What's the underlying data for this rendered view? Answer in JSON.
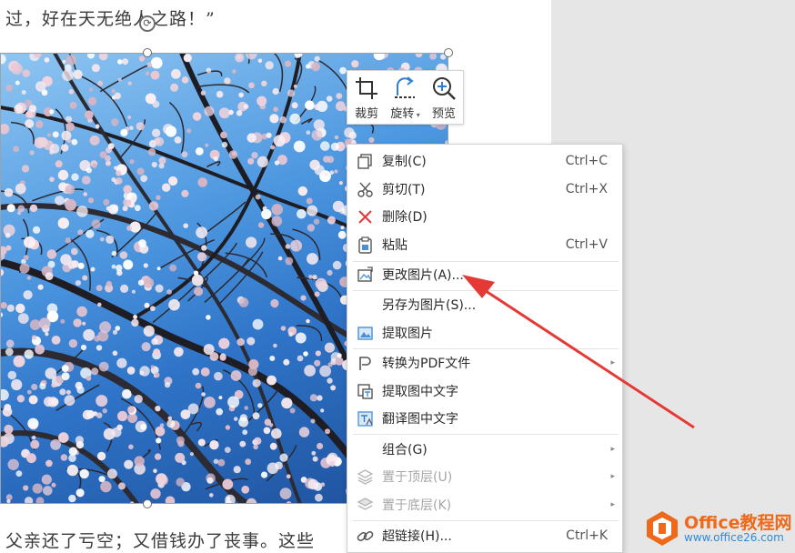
{
  "document": {
    "line_top": "过，好在天无绝人之路！”",
    "line_bottom": "父亲还了亏空；又借钱办了丧事。这些"
  },
  "image_toolbar": {
    "buttons": [
      {
        "label": "裁剪",
        "icon": "crop-icon"
      },
      {
        "label": "旋转",
        "icon": "rotate-icon"
      },
      {
        "label": "预览",
        "icon": "preview-zoom-icon"
      }
    ]
  },
  "context_menu": {
    "items": [
      {
        "label": "复制(C)",
        "shortcut": "Ctrl+C",
        "icon": "copy-icon"
      },
      {
        "label": "剪切(T)",
        "shortcut": "Ctrl+X",
        "icon": "cut-icon"
      },
      {
        "label": "删除(D)",
        "shortcut": "",
        "icon": "delete-icon"
      },
      {
        "label": "粘贴",
        "shortcut": "Ctrl+V",
        "icon": "paste-icon"
      },
      {
        "label": "更改图片(A)...",
        "shortcut": "",
        "icon": "change-picture-icon"
      },
      {
        "label": "另存为图片(S)...",
        "shortcut": "",
        "icon": ""
      },
      {
        "label": "提取图片",
        "shortcut": "",
        "icon": "extract-picture-icon"
      },
      {
        "label": "转换为PDF文件",
        "shortcut": "",
        "icon": "pdf-convert-icon"
      },
      {
        "label": "提取图中文字",
        "shortcut": "",
        "icon": "ocr-extract-icon"
      },
      {
        "label": "翻译图中文字",
        "shortcut": "",
        "icon": "translate-icon"
      },
      {
        "label": "组合(G)",
        "shortcut": "",
        "icon": ""
      },
      {
        "label": "置于顶层(U)",
        "shortcut": "",
        "icon": "bring-to-front-icon"
      },
      {
        "label": "置于底层(K)",
        "shortcut": "",
        "icon": "send-to-back-icon"
      },
      {
        "label": "超链接(H)...",
        "shortcut": "Ctrl+K",
        "icon": "hyperlink-icon"
      }
    ]
  },
  "watermark": {
    "name": "Office教程网",
    "url": "www.office26.com"
  },
  "colors": {
    "accent_red": "#e53935",
    "logo_orange": "#ee6a1a",
    "logo_blue": "#2e8ad6"
  }
}
